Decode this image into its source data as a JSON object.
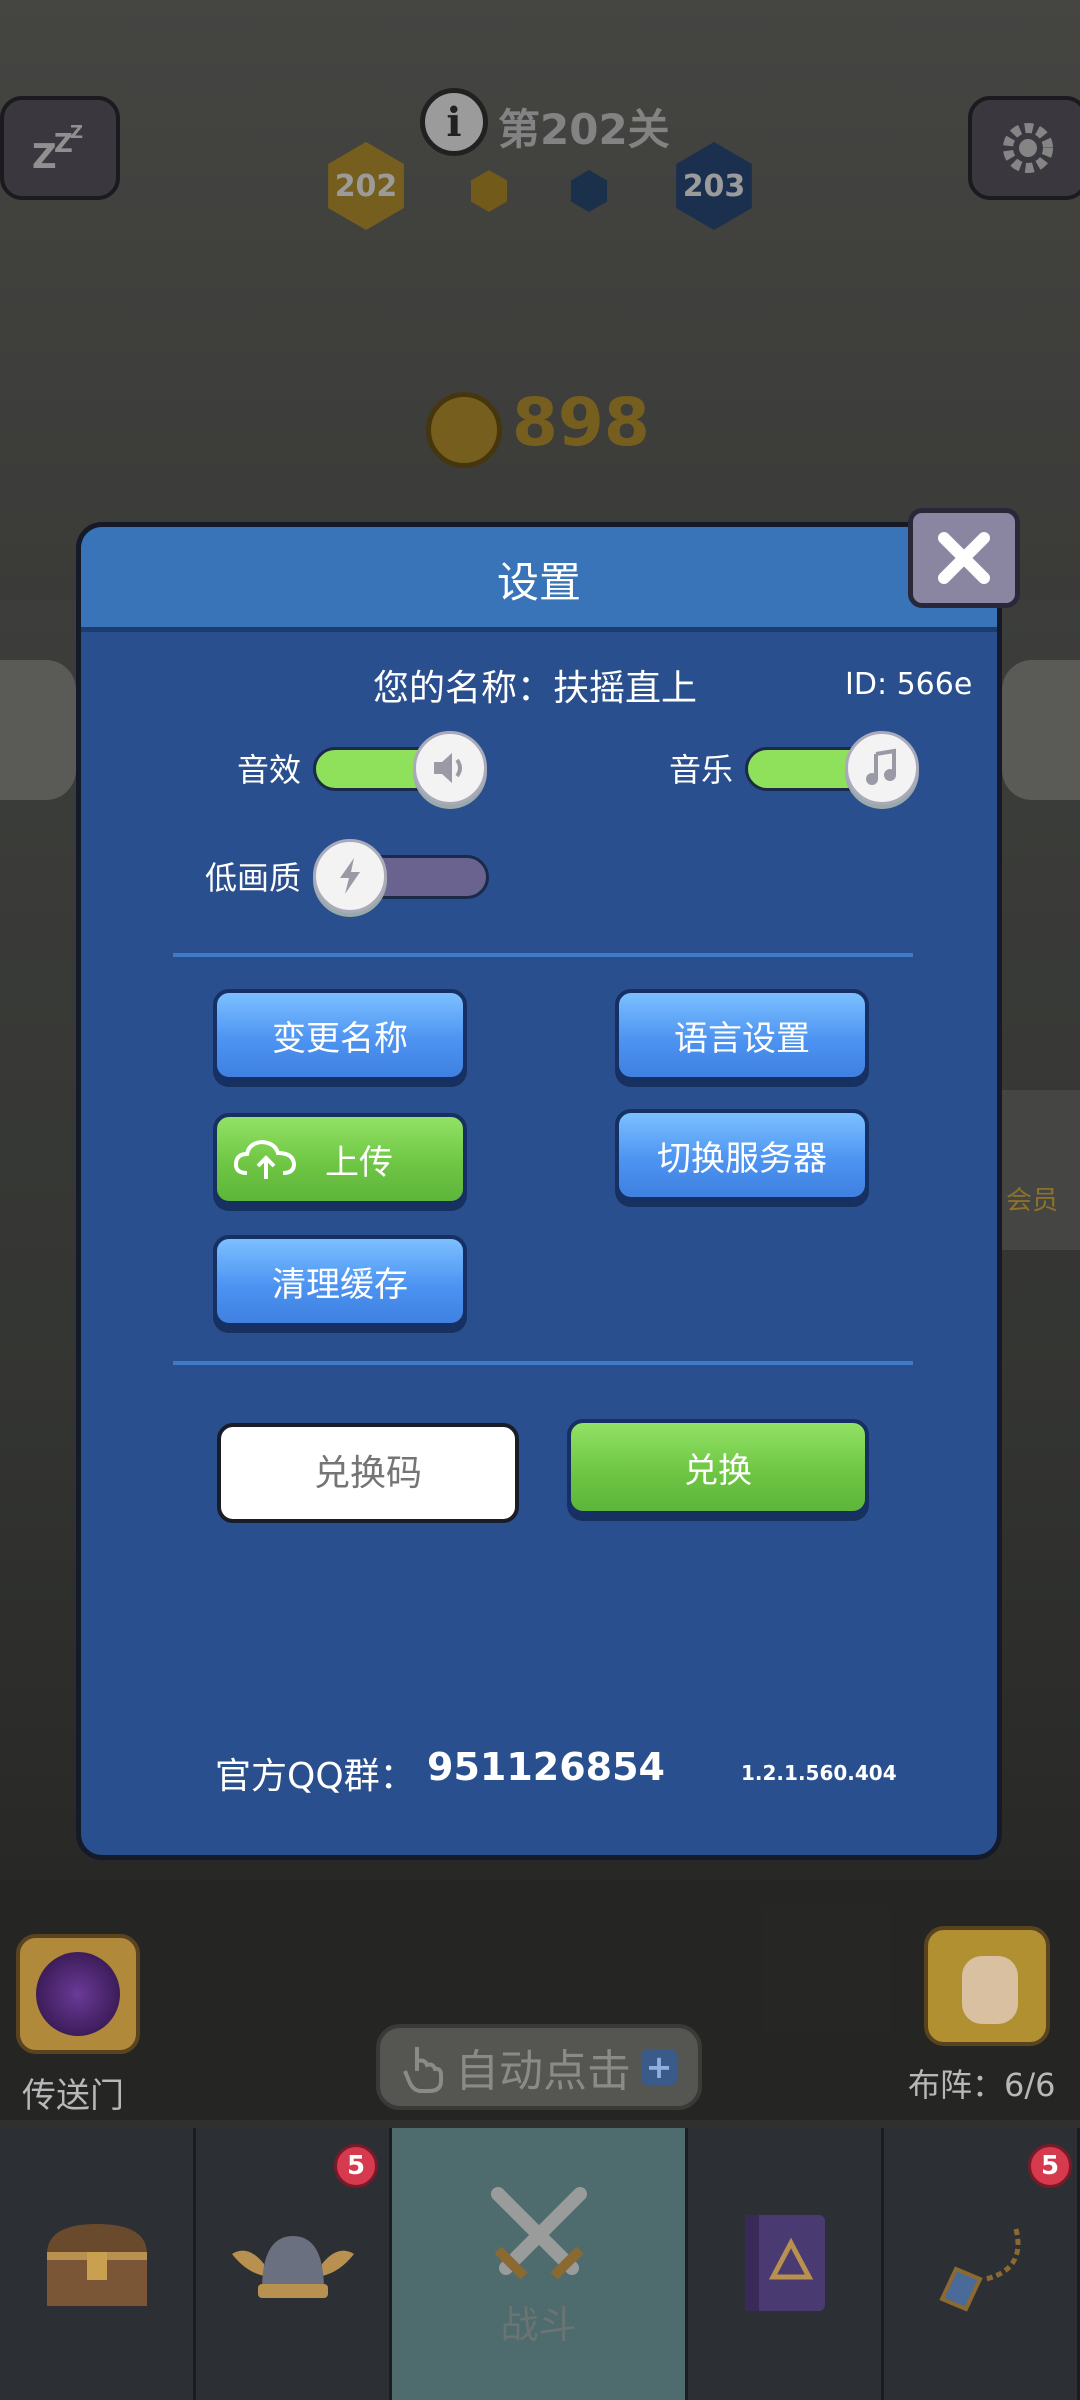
{
  "level": {
    "label": "第202关",
    "current": "202",
    "next": "203"
  },
  "coins": "898",
  "settings": {
    "title": "设置",
    "name_label": "您的名称：扶摇直上",
    "id_label": "ID: 566e",
    "sound_label": "音效",
    "music_label": "音乐",
    "low_quality_label": "低画质",
    "buttons": {
      "change_name": "变更名称",
      "language": "语言设置",
      "upload": "上传",
      "switch_server": "切换服务器",
      "clear_cache": "清理缓存",
      "redeem": "兑换"
    },
    "redeem_placeholder": "兑换码",
    "qq_group_label": "官方QQ群：",
    "qq_group_number": "951126854",
    "version": "1.2.1.560.404"
  },
  "bottom_hud": {
    "portal_label": "传送门",
    "auto_click_label": "自动点击",
    "formation_label": "布阵：6/6",
    "side_label": "会员"
  },
  "nav": {
    "battle_label": "战斗",
    "heroes_badge": "5",
    "items_badge": "5"
  },
  "colors": {
    "accent_green": "#8fe05a",
    "accent_blue": "#4d94f2",
    "dialog_bg": "#2a4f8e"
  }
}
